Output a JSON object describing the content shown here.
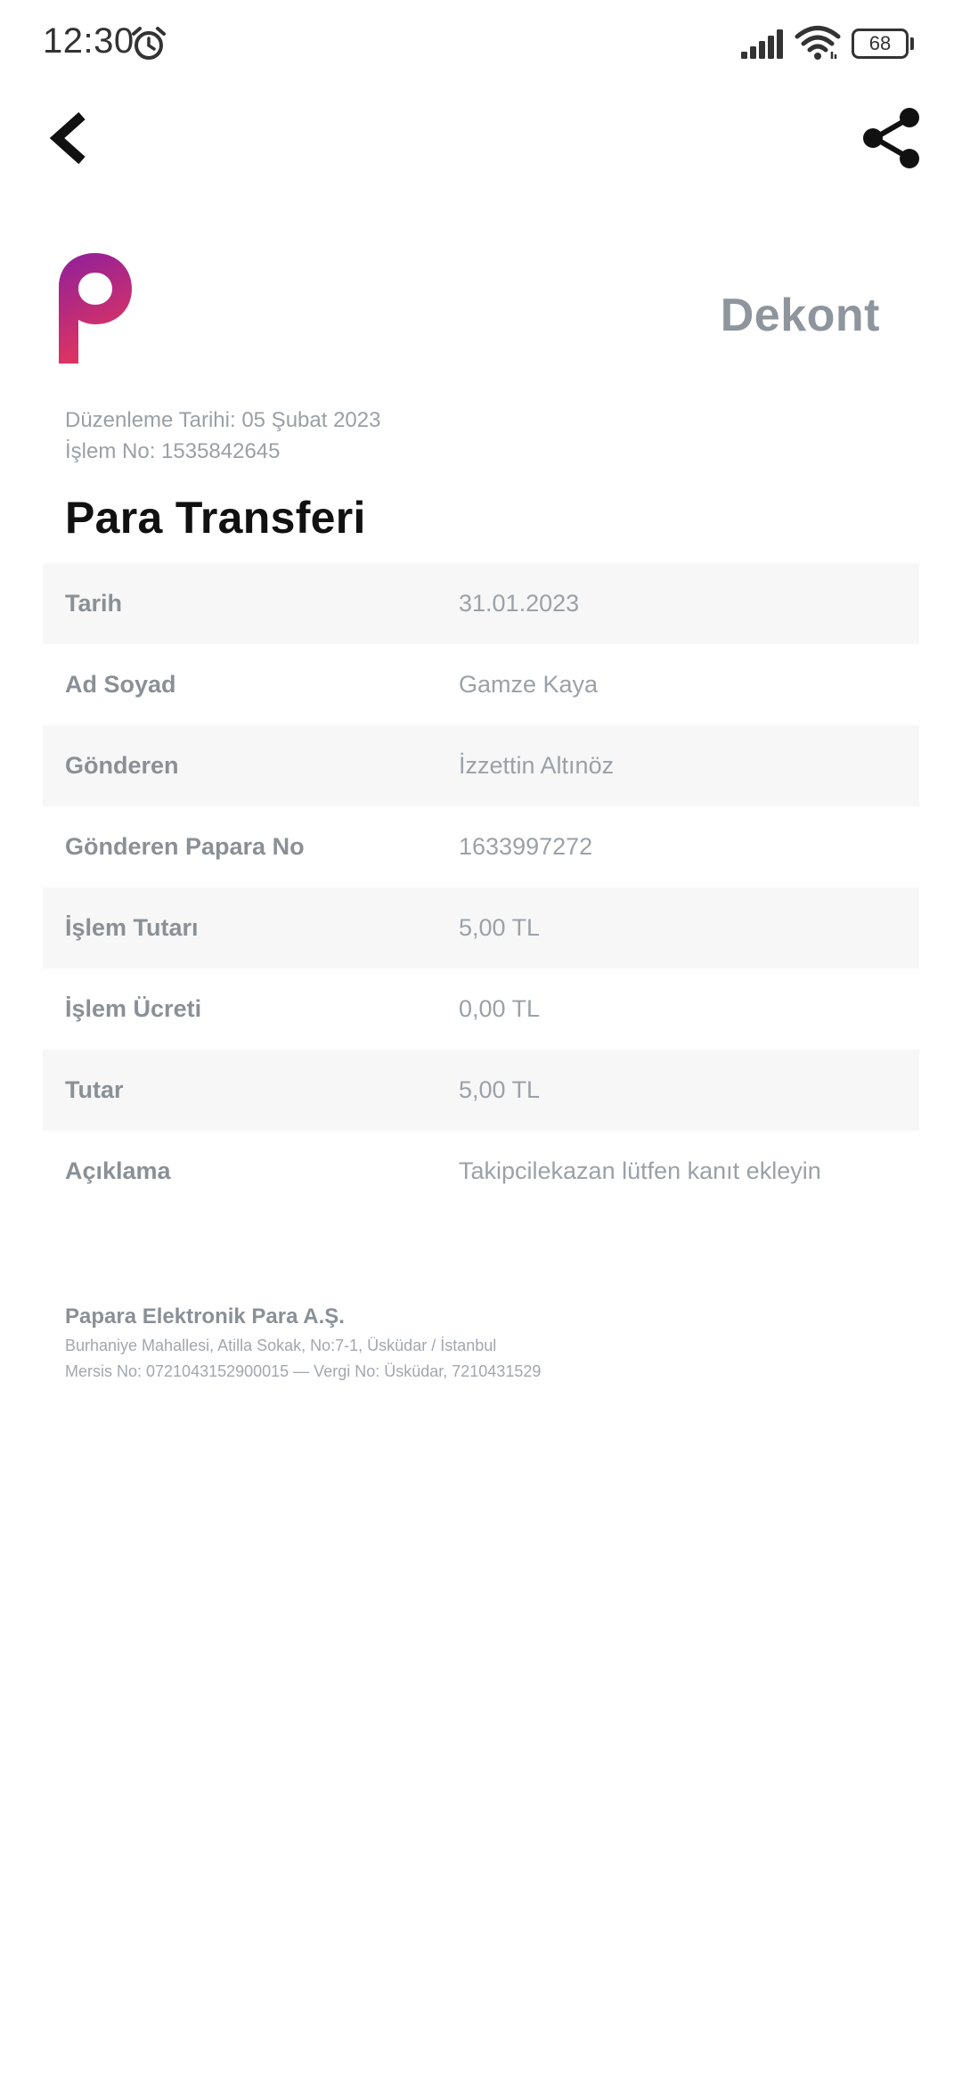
{
  "status_bar": {
    "time": "12:30",
    "battery_level": "68",
    "icons": [
      "alarm-icon",
      "signal-icon",
      "wifi-icon",
      "battery-icon"
    ]
  },
  "toolbar": {
    "back_icon": "chevron-left-icon",
    "share_icon": "share-icon"
  },
  "receipt": {
    "logo": "papara-logo",
    "label": "Dekont",
    "issue_date": "Düzenleme Tarihi: 05 Şubat 2023",
    "transaction_no": "İşlem No: 1535842645",
    "title": "Para Transferi",
    "details": [
      {
        "label": "Tarih",
        "value": "31.01.2023"
      },
      {
        "label": "Ad Soyad",
        "value": "Gamze Kaya"
      },
      {
        "label": "Gönderen",
        "value": "İzzettin Altınöz"
      },
      {
        "label": "Gönderen Papara No",
        "value": "1633997272"
      },
      {
        "label": "İşlem Tutarı",
        "value": "5,00 TL"
      },
      {
        "label": "İşlem Ücreti",
        "value": "0,00 TL"
      },
      {
        "label": "Tutar",
        "value": "5,00 TL"
      },
      {
        "label": "Açıklama",
        "value": "Takipcilekazan lütfen kanıt ekleyin"
      }
    ]
  },
  "footer": {
    "company": "Papara Elektronik Para A.Ş.",
    "address": "Burhaniye Mahallesi, Atilla Sokak, No:7-1, Üsküdar / İstanbul",
    "registry": "Mersis No: 0721043152900015 — Vergi No: Üsküdar, 7210431529"
  },
  "colors": {
    "logo_gradient_top": "#8e1f9c",
    "logo_gradient_bottom": "#e0355f",
    "label_gray": "#8e959c",
    "row_stripe": "#f7f7f8"
  }
}
